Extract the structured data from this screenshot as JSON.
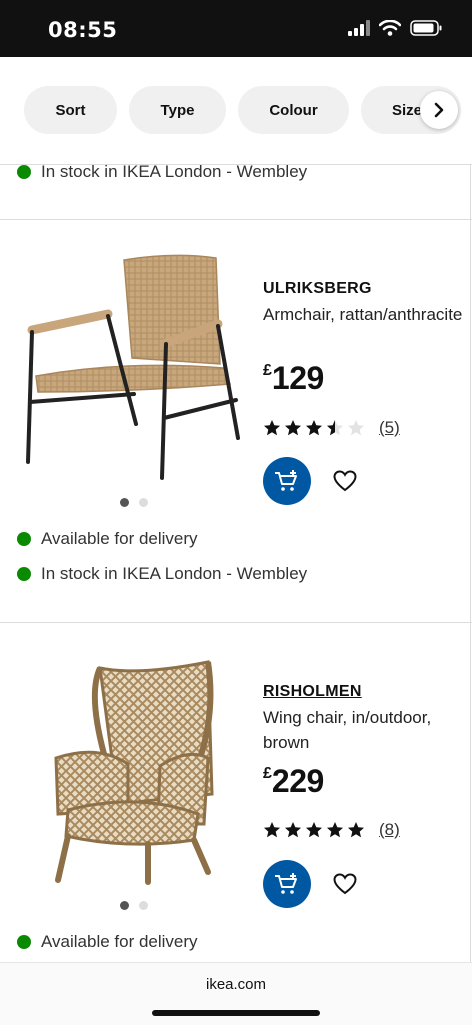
{
  "status": {
    "time": "08:55"
  },
  "filters": [
    {
      "label": "Sort"
    },
    {
      "label": "Type"
    },
    {
      "label": "Colour"
    },
    {
      "label": "Size"
    }
  ],
  "top_stock": "In stock in IKEA London - Wembley",
  "products": [
    {
      "name": "ULRIKSBERG",
      "desc": "Armchair, rattan/anthracite",
      "currency": "£",
      "price": "129",
      "rating": 3.5,
      "rating_count": "(5)",
      "image_count": 2,
      "active_image": 1,
      "availability": [
        "Available for delivery",
        "In stock in IKEA London - Wembley"
      ]
    },
    {
      "name": "RISHOLMEN",
      "desc": "Wing chair, in/outdoor, brown",
      "currency": "£",
      "price": "229",
      "rating": 5,
      "rating_count": "(8)",
      "image_count": 2,
      "active_image": 1,
      "availability": [
        "Available for delivery"
      ]
    }
  ],
  "footer": {
    "url": "ikea.com"
  },
  "colors": {
    "accent": "#0058a3",
    "in_stock": "#0a8a00",
    "chip_bg": "#f0f0f0"
  }
}
